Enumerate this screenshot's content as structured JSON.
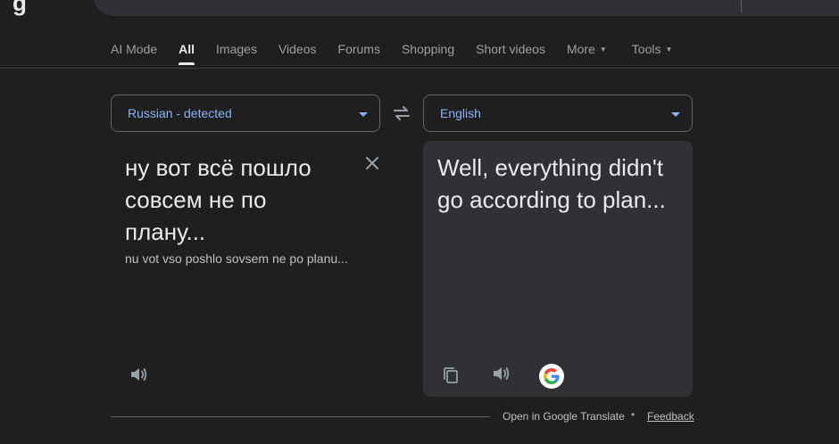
{
  "header": {
    "logo_fragment": "g"
  },
  "tabs": [
    {
      "label": "AI Mode",
      "active": false
    },
    {
      "label": "All",
      "active": true
    },
    {
      "label": "Images",
      "active": false
    },
    {
      "label": "Videos",
      "active": false
    },
    {
      "label": "Forums",
      "active": false
    },
    {
      "label": "Shopping",
      "active": false
    },
    {
      "label": "Short videos",
      "active": false
    },
    {
      "label": "More",
      "active": false,
      "dropdown": true
    },
    {
      "label": "Tools",
      "active": false,
      "dropdown": true
    }
  ],
  "translator": {
    "source_language": "Russian - detected",
    "target_language": "English",
    "source_text": "ну вот всё пошло совсем не по плану...",
    "transliteration": "nu vot vso poshlo sovsem ne po planu...",
    "translated_text": "Well, everything didn't go according to plan...",
    "icons": {
      "swap": "swap-languages-icon",
      "clear": "close-icon",
      "source_speaker": "speaker-icon",
      "copy": "copy-icon",
      "target_speaker": "speaker-icon",
      "google": "google-g-icon"
    }
  },
  "footer": {
    "open_link": "Open in Google Translate",
    "separator": "•",
    "feedback": "Feedback"
  },
  "colors": {
    "background": "#1f1f1f",
    "card": "#303134",
    "accent": "#8ab4f8",
    "text": "#e8eaed",
    "muted": "#9aa0a6"
  }
}
